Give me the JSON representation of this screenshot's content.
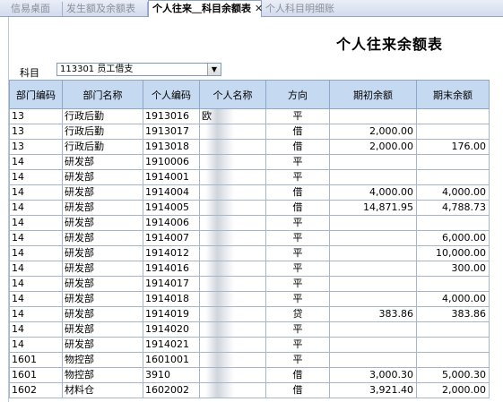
{
  "tabs": [
    {
      "label": "信易桌面",
      "active": false
    },
    {
      "label": "发生额及余额表",
      "active": false
    },
    {
      "label": "个人往来＿科目余额表",
      "active": true
    },
    {
      "label": "个人科目明细账",
      "active": false
    }
  ],
  "close_glyph": "✕",
  "report": {
    "title": "个人往来余额表",
    "subject_label": "科目",
    "subject_value": "113301 员工借支"
  },
  "table": {
    "columns": [
      "部门编码",
      "部门名称",
      "个人编码",
      "个人名称",
      "方向",
      "期初余额",
      "期末余额"
    ],
    "rows": [
      [
        "13",
        "行政后勤",
        "1913016",
        "欧",
        "平",
        "",
        ""
      ],
      [
        "13",
        "行政后勤",
        "1913017",
        "",
        "借",
        "2,000.00",
        ""
      ],
      [
        "13",
        "行政后勤",
        "1913018",
        "",
        "借",
        "2,000.00",
        "176.00"
      ],
      [
        "14",
        "研发部",
        "1910006",
        "",
        "平",
        "",
        ""
      ],
      [
        "14",
        "研发部",
        "1914001",
        "",
        "平",
        "",
        ""
      ],
      [
        "14",
        "研发部",
        "1914004",
        "",
        "借",
        "4,000.00",
        "4,000.00"
      ],
      [
        "14",
        "研发部",
        "1914005",
        "",
        "借",
        "14,871.95",
        "4,788.73"
      ],
      [
        "14",
        "研发部",
        "1914006",
        "",
        "平",
        "",
        ""
      ],
      [
        "14",
        "研发部",
        "1914007",
        "",
        "平",
        "",
        "6,000.00"
      ],
      [
        "14",
        "研发部",
        "1914012",
        "",
        "平",
        "",
        "10,000.00"
      ],
      [
        "14",
        "研发部",
        "1914016",
        "",
        "平",
        "",
        "300.00"
      ],
      [
        "14",
        "研发部",
        "1914017",
        "",
        "平",
        "",
        ""
      ],
      [
        "14",
        "研发部",
        "1914018",
        "",
        "平",
        "",
        "4,000.00"
      ],
      [
        "14",
        "研发部",
        "1914019",
        "",
        "贷",
        "383.86",
        "383.86"
      ],
      [
        "14",
        "研发部",
        "1914020",
        "",
        "平",
        "",
        ""
      ],
      [
        "14",
        "研发部",
        "1914021",
        "",
        "平",
        "",
        ""
      ],
      [
        "1601",
        "物控部",
        "1601001",
        "",
        "平",
        "",
        ""
      ],
      [
        "1601",
        "物控部",
        "3910",
        "",
        "借",
        "3,000.30",
        "5,000.30"
      ],
      [
        "1602",
        "材料仓",
        "1602002",
        "",
        "借",
        "3,921.40",
        "2,000.00"
      ]
    ]
  }
}
